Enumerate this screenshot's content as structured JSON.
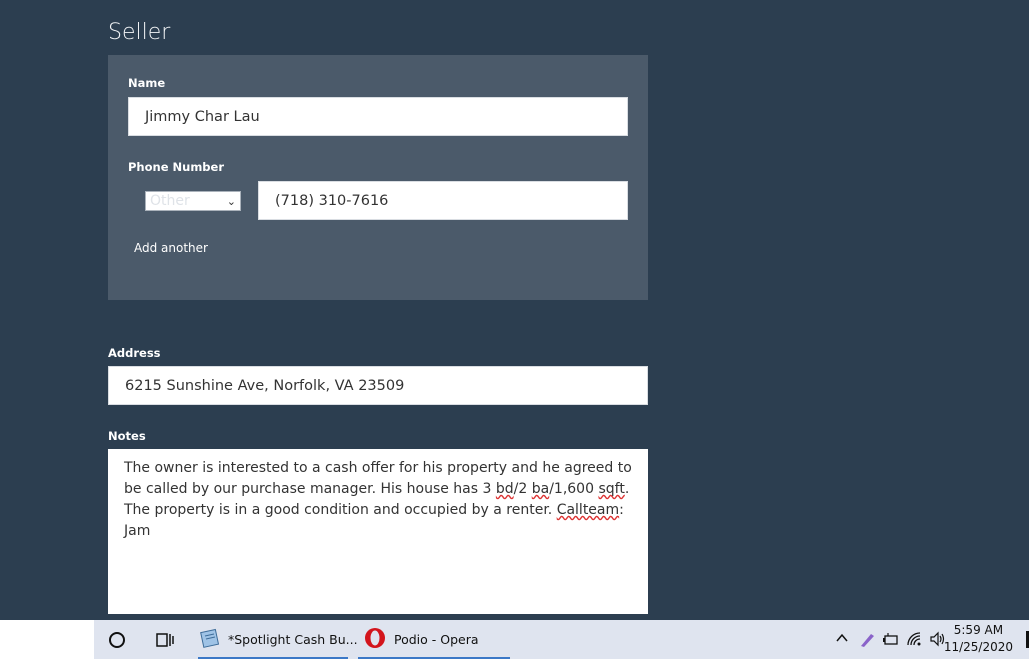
{
  "seller": {
    "title": "Seller",
    "name_label": "Name",
    "name_value": "Jimmy Char Lau",
    "phone_label": "Phone Number",
    "phone_type": "Other",
    "phone_value": "(718) 310-7616",
    "add_another": "Add another"
  },
  "address": {
    "label": "Address",
    "value": "6215 Sunshine Ave, Norfolk, VA 23509"
  },
  "notes": {
    "label": "Notes",
    "segments": [
      "The owner is interested to a cash offer for his property and he agreed to be called by our purchase manager. His house has 3 ",
      "bd",
      "/2 ",
      "ba",
      "/1,600 ",
      "sqft",
      ". The property is in a good condition and occupied by a renter.  ",
      "Callteam",
      ": Jam"
    ]
  },
  "taskbar": {
    "start_icon": "cortana-circle-icon",
    "task_view_icon": "task-view-icon",
    "apps": [
      {
        "label": "*Spotlight Cash Bu...",
        "icon": "notepad-icon"
      },
      {
        "label": "Podio - Opera",
        "icon": "opera-icon"
      }
    ],
    "tray_icons": [
      "chevron-up-icon",
      "pen-icon",
      "battery-icon",
      "wifi-icon",
      "speaker-icon"
    ],
    "time": "5:59 AM",
    "date": "11/25/2020"
  }
}
